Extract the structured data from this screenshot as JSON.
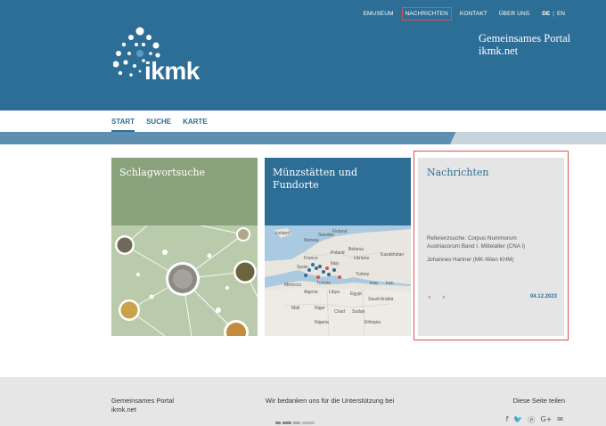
{
  "topnav": {
    "items": [
      {
        "label": "EMUSEUM"
      },
      {
        "label": "NACHRICHTEN"
      },
      {
        "label": "KONTAKT"
      },
      {
        "label": "ÜBER UNS"
      }
    ],
    "lang": {
      "de": "DE",
      "sep": "|",
      "en": "EN"
    }
  },
  "logo": {
    "text": "ikmk"
  },
  "portal": {
    "line1": "Gemeinsames Portal",
    "line2": "ikmk.net"
  },
  "subnav": {
    "tabs": [
      {
        "label": "START"
      },
      {
        "label": "SUCHE"
      },
      {
        "label": "KARTE"
      }
    ]
  },
  "cards": [
    {
      "title": "Schlagwortsuche"
    },
    {
      "title_line1": "Münzstätten und",
      "title_line2": "Fundorte"
    },
    {
      "title": "Nachrichten",
      "text_line1": "Referenzsuche: Corpus Nummorum",
      "text_line2": "Austriacorum Band I. Mittelalter (CNA I)",
      "author": "Johannes Hartner (MK-Wien KHM)",
      "date": "04.12.2023",
      "prev": "‹",
      "next": "›"
    }
  ],
  "map_labels": [
    "Iceland",
    "Sweden",
    "Norway",
    "Finland",
    "Belarus",
    "Poland",
    "Ukraine",
    "Kazakhstan",
    "Spain",
    "Italy",
    "France",
    "Turkey",
    "Morocco",
    "Algeria",
    "Tunisia",
    "Libya",
    "Egypt",
    "Iraq",
    "Iran",
    "Saudi Arabia",
    "Mali",
    "Niger",
    "Chad",
    "Sudan",
    "Nigeria",
    "Ethiopia"
  ],
  "footer": {
    "portal_line1": "Gemeinsames Portal",
    "portal_line2": "ikmk.net",
    "thanks": "Wir bedanken uns für die Unterstützung bei",
    "share": "Diese Seite teilen",
    "social": [
      "f",
      "🐦",
      "ⓟ",
      "G+",
      "✉"
    ]
  },
  "colors": {
    "header": "#2d6e97",
    "card_green": "#8aa27b",
    "card_blue": "#2d6e97",
    "card_gray": "#e5e5e5",
    "accent": "#e0702c",
    "highlight": "#d9534f"
  }
}
